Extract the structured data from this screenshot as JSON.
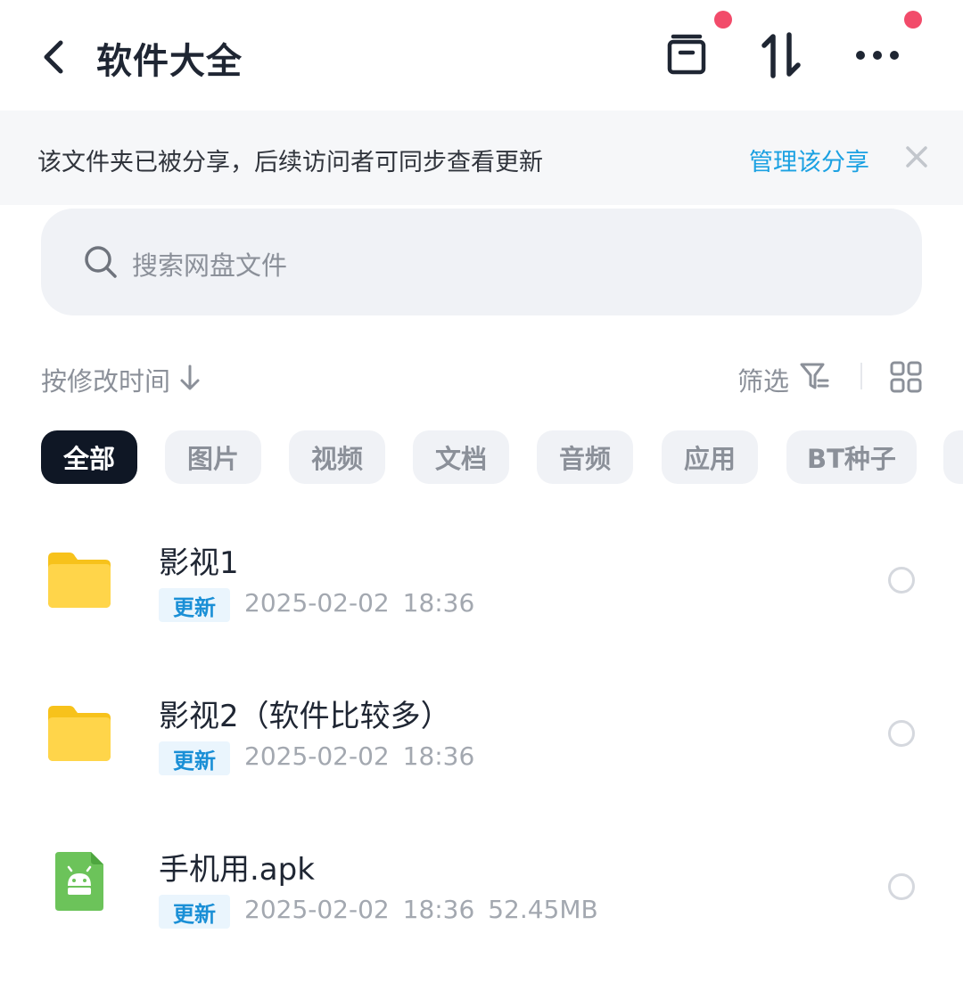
{
  "header": {
    "title": "软件大全",
    "icons": [
      "back-icon",
      "archive-icon",
      "transfer-icon",
      "more-icon"
    ],
    "badge_color": "#f24b6a"
  },
  "banner": {
    "text": "该文件夹已被分享，后续访问者可同步查看更新",
    "link": "管理该分享",
    "link_color": "#1ba1e2"
  },
  "search": {
    "placeholder": "搜索网盘文件"
  },
  "sort": {
    "label": "按修改时间",
    "filter_label": "筛选"
  },
  "categories": [
    "全部",
    "图片",
    "视频",
    "文档",
    "音频",
    "应用",
    "BT种子"
  ],
  "files": [
    {
      "name": "影视1",
      "tag": "更新",
      "meta": "2025-02-02 18:36",
      "icon": "folder-icon"
    },
    {
      "name": "影视2（软件比较多）",
      "tag": "更新",
      "meta": "2025-02-02 18:36",
      "icon": "folder-icon"
    },
    {
      "name": "手机用.apk",
      "tag": "更新",
      "meta": "2025-02-02 18:36 52.45MB",
      "icon": "apk-icon"
    }
  ]
}
